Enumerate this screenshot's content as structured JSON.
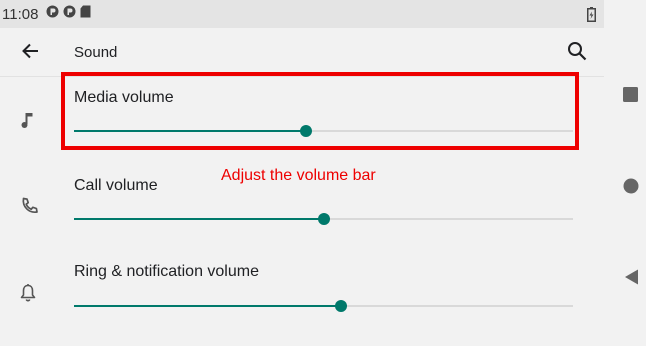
{
  "status_bar": {
    "time": "11:08",
    "icons": [
      "notification-app-icon",
      "notification-app-icon",
      "sd-card-icon",
      "battery-icon"
    ]
  },
  "app_bar": {
    "title": "Sound",
    "back_icon": "arrow-back-icon",
    "search_icon": "search-icon"
  },
  "settings": [
    {
      "label": "Media volume",
      "icon": "music-note-icon",
      "value_percent": 46.5
    },
    {
      "label": "Call volume",
      "icon": "phone-icon",
      "value_percent": 50
    },
    {
      "label": "Ring & notification volume",
      "icon": "bell-icon",
      "value_percent": 53.5
    }
  ],
  "annotation": {
    "text": "Adjust the volume bar",
    "color": "#ee0000"
  },
  "colors": {
    "accent": "#00796b",
    "track": "#d9d9d9"
  },
  "nav_bar": {
    "icons": [
      "recents-square-icon",
      "home-circle-icon",
      "back-triangle-icon"
    ]
  }
}
